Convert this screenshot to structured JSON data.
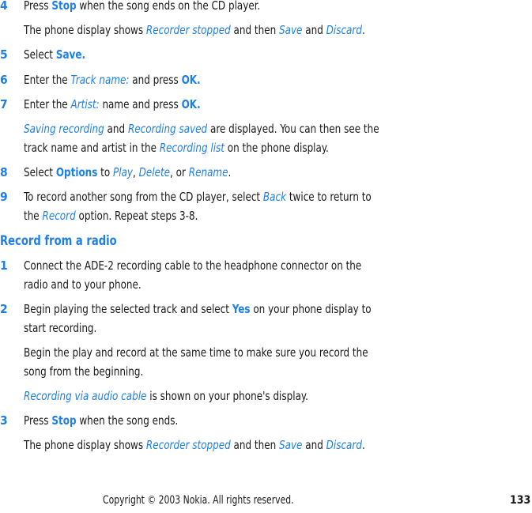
{
  "section1": {
    "step4": {
      "num": "4",
      "a": "Press ",
      "b": "Stop",
      "c": " when the song ends on the CD player."
    },
    "note4": {
      "a": "The phone display shows ",
      "b": "Recorder stopped",
      "c": " and then ",
      "d": "Save",
      "e": " and ",
      "f": "Discard",
      "g": "."
    },
    "step5": {
      "num": "5",
      "a": "Select ",
      "b": "Save."
    },
    "step6": {
      "num": "6",
      "a": "Enter the ",
      "b": "Track name:",
      "c": " and press ",
      "d": "OK."
    },
    "step7": {
      "num": "7",
      "a": "Enter the ",
      "b": "Artist:",
      "c": " name and press ",
      "d": "OK."
    },
    "note7": {
      "a": "Saving recording",
      "b": " and ",
      "c": "Recording saved",
      "d": " are displayed. You can then see the",
      "e": "track name and artist in the ",
      "f": "Recording list",
      "g": " on the phone display."
    },
    "step8": {
      "num": "8",
      "a": "Select ",
      "b": "Options",
      "c": " to ",
      "d": "Play",
      "e": ", ",
      "f": "Delete",
      "g": ", or ",
      "h": "Rename",
      "i": "."
    },
    "step9": {
      "num": "9",
      "a": "To record another song from the CD player, select ",
      "b": "Back",
      "c": " twice to return to",
      "d": "the ",
      "e": "Record",
      "f": " option. Repeat steps 3-8."
    }
  },
  "section2": {
    "heading": "Record from a radio",
    "step1": {
      "num": "1",
      "a": "Connect the ADE-2 recording cable to the headphone connector on the",
      "b": "radio and to your phone."
    },
    "step2": {
      "num": "2",
      "a": "Begin playing the selected track and select ",
      "b": "Yes",
      "c": " on your phone display to",
      "d": "start recording."
    },
    "note2a": {
      "a": "Begin the play and record at the same time to make sure you record the",
      "b": "song from the beginning."
    },
    "note2b": {
      "a": "Recording via audio cable",
      "b": " is shown on your phone's display."
    },
    "step3": {
      "num": "3",
      "a": "Press ",
      "b": "Stop",
      "c": " when the song ends."
    },
    "note3": {
      "a": "The phone display shows ",
      "b": "Recorder stopped",
      "c": " and then ",
      "d": "Save",
      "e": " and ",
      "f": "Discard",
      "g": "."
    }
  },
  "footer": {
    "copyright": "Copyright © 2003 Nokia. All rights reserved.",
    "page": "133"
  }
}
